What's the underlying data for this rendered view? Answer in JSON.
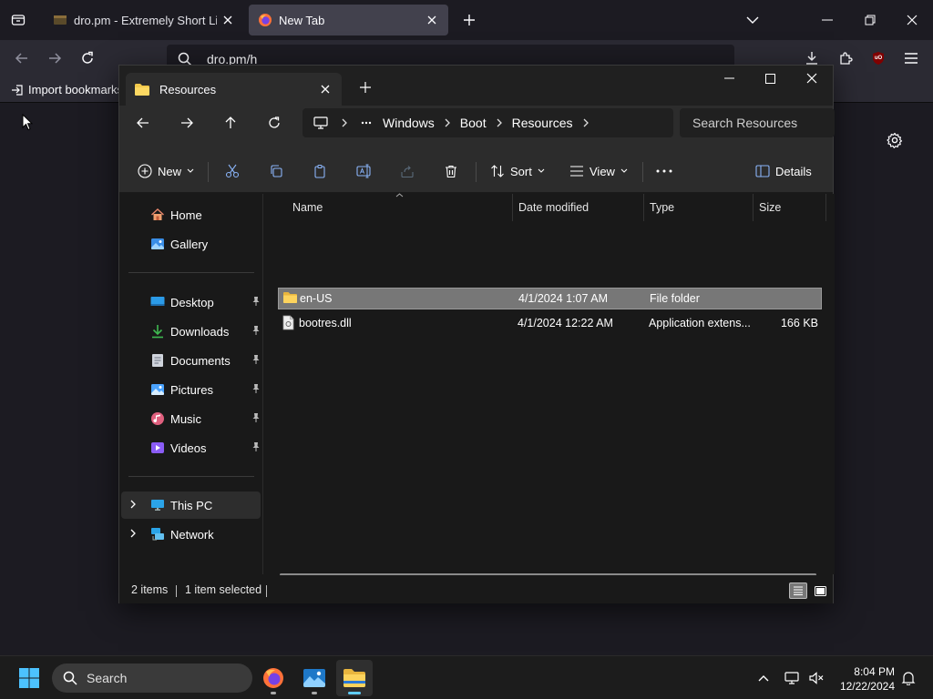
{
  "browser": {
    "tabs": [
      {
        "title": "dro.pm - Extremely Short Links",
        "active": false
      },
      {
        "title": "New Tab",
        "active": true
      }
    ],
    "url": "dro.pm/h",
    "bookmarks_item": "Import bookmarks...",
    "extension_badge": "uO"
  },
  "explorer": {
    "tab_title": "Resources",
    "breadcrumbs": [
      "Windows",
      "Boot",
      "Resources"
    ],
    "search_placeholder": "Search Resources",
    "commands": {
      "new": "New",
      "sort": "Sort",
      "view": "View",
      "details": "Details"
    },
    "nav": {
      "quick": [
        {
          "label": "Home",
          "icon": "home-icon"
        },
        {
          "label": "Gallery",
          "icon": "gallery-icon"
        }
      ],
      "pinned": [
        {
          "label": "Desktop",
          "icon": "desktop-icon"
        },
        {
          "label": "Downloads",
          "icon": "downloads-icon"
        },
        {
          "label": "Documents",
          "icon": "documents-icon"
        },
        {
          "label": "Pictures",
          "icon": "pictures-icon"
        },
        {
          "label": "Music",
          "icon": "music-icon"
        },
        {
          "label": "Videos",
          "icon": "videos-icon"
        }
      ],
      "tree": [
        {
          "label": "This PC",
          "icon": "pc-icon",
          "selected": true
        },
        {
          "label": "Network",
          "icon": "network-icon",
          "selected": false
        }
      ]
    },
    "columns": [
      "Name",
      "Date modified",
      "Type",
      "Size"
    ],
    "files": [
      {
        "name": "en-US",
        "date": "4/1/2024 1:07 AM",
        "type": "File folder",
        "size": "",
        "selected": true
      },
      {
        "name": "bootres.dll",
        "date": "4/1/2024 12:22 AM",
        "type": "Application extens...",
        "size": "166 KB",
        "selected": false
      }
    ],
    "status": {
      "count": "2 items",
      "selection": "1 item selected"
    }
  },
  "taskbar": {
    "search_placeholder": "Search",
    "time": "8:04 PM",
    "date": "12/22/2024"
  },
  "colors": {
    "accent": "#60cdff",
    "folder": "#f2c94c",
    "selection": "#777777"
  }
}
